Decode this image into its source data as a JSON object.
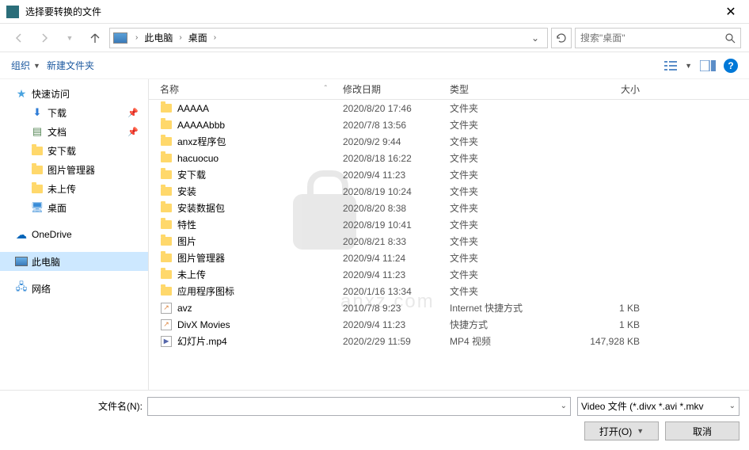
{
  "window": {
    "title": "选择要转换的文件"
  },
  "breadcrumb": {
    "items": [
      "此电脑",
      "桌面"
    ]
  },
  "search": {
    "placeholder": "搜索\"桌面\""
  },
  "toolbar": {
    "organize": "组织",
    "newfolder": "新建文件夹"
  },
  "sidebar": {
    "quickaccess": "快速访问",
    "downloads": "下载",
    "documents": "文档",
    "anxiazai": "安下载",
    "picmanager": "图片管理器",
    "notuploaded": "未上传",
    "desktop": "桌面",
    "onedrive": "OneDrive",
    "thispc": "此电脑",
    "network": "网络"
  },
  "columns": {
    "name": "名称",
    "date": "修改日期",
    "type": "类型",
    "size": "大小"
  },
  "files": [
    {
      "name": "AAAAA",
      "date": "2020/8/20 17:46",
      "type": "文件夹",
      "size": "",
      "kind": "folder"
    },
    {
      "name": "AAAAAbbb",
      "date": "2020/7/8 13:56",
      "type": "文件夹",
      "size": "",
      "kind": "folder"
    },
    {
      "name": "anxz程序包",
      "date": "2020/9/2 9:44",
      "type": "文件夹",
      "size": "",
      "kind": "folder"
    },
    {
      "name": "hacuocuo",
      "date": "2020/8/18 16:22",
      "type": "文件夹",
      "size": "",
      "kind": "folder"
    },
    {
      "name": "安下载",
      "date": "2020/9/4 11:23",
      "type": "文件夹",
      "size": "",
      "kind": "folder"
    },
    {
      "name": "安装",
      "date": "2020/8/19 10:24",
      "type": "文件夹",
      "size": "",
      "kind": "folder"
    },
    {
      "name": "安装数据包",
      "date": "2020/8/20 8:38",
      "type": "文件夹",
      "size": "",
      "kind": "folder"
    },
    {
      "name": "特性",
      "date": "2020/8/19 10:41",
      "type": "文件夹",
      "size": "",
      "kind": "folder"
    },
    {
      "name": "图片",
      "date": "2020/8/21 8:33",
      "type": "文件夹",
      "size": "",
      "kind": "folder"
    },
    {
      "name": "图片管理器",
      "date": "2020/9/4 11:24",
      "type": "文件夹",
      "size": "",
      "kind": "folder"
    },
    {
      "name": "未上传",
      "date": "2020/9/4 11:23",
      "type": "文件夹",
      "size": "",
      "kind": "folder"
    },
    {
      "name": "应用程序图标",
      "date": "2020/1/16 13:34",
      "type": "文件夹",
      "size": "",
      "kind": "folder"
    },
    {
      "name": "avz",
      "date": "2010/7/8 9:23",
      "type": "Internet 快捷方式",
      "size": "1 KB",
      "kind": "link"
    },
    {
      "name": "DivX Movies",
      "date": "2020/9/4 11:23",
      "type": "快捷方式",
      "size": "1 KB",
      "kind": "link"
    },
    {
      "name": "幻灯片.mp4",
      "date": "2020/2/29 11:59",
      "type": "MP4 视频",
      "size": "147,928 KB",
      "kind": "mp4"
    }
  ],
  "bottom": {
    "filename_label": "文件名(N):",
    "filename_value": "",
    "filter": "Video 文件 (*.divx *.avi *.mkv",
    "open": "打开(O)",
    "cancel": "取消"
  },
  "watermark": "anxz.com"
}
